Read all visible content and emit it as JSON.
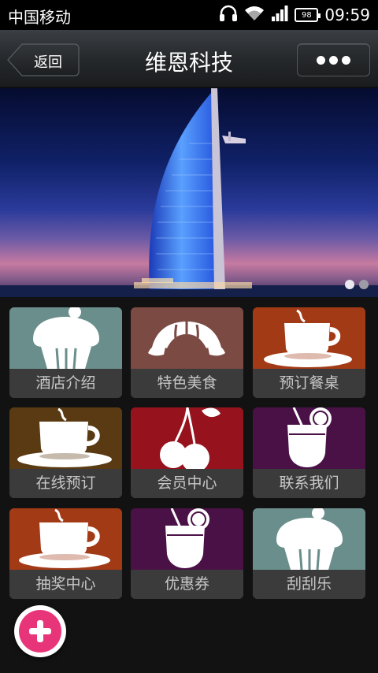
{
  "status_bar": {
    "carrier": "中国移动",
    "battery": "98",
    "time": "09:59"
  },
  "nav": {
    "back_label": "返回",
    "title": "维恩科技"
  },
  "banner": {
    "pages": 2,
    "active_page": 1
  },
  "menu": [
    {
      "label": "酒店介绍",
      "icon": "cupcake-icon",
      "color": "#6a8e8b"
    },
    {
      "label": "特色美食",
      "icon": "croissant-icon",
      "color": "#7b4a43"
    },
    {
      "label": "预订餐桌",
      "icon": "coffee-cup-icon",
      "color": "#a33a16"
    },
    {
      "label": "在线预订",
      "icon": "coffee-cup-icon",
      "color": "#5a3a12"
    },
    {
      "label": "会员中心",
      "icon": "cherries-icon",
      "color": "#96121d"
    },
    {
      "label": "联系我们",
      "icon": "cocktail-icon",
      "color": "#4a1147"
    },
    {
      "label": "抽奖中心",
      "icon": "coffee-cup-icon",
      "color": "#a33a16"
    },
    {
      "label": "优惠券",
      "icon": "cocktail-icon",
      "color": "#4a1147"
    },
    {
      "label": "刮刮乐",
      "icon": "cupcake-icon",
      "color": "#6a8e8b"
    }
  ],
  "fab": {
    "icon": "plus-icon",
    "color": "#e8357a"
  }
}
